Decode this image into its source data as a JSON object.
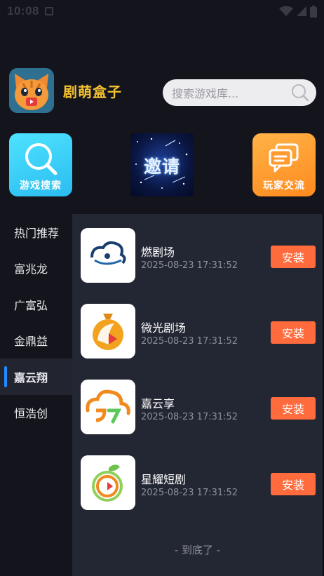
{
  "status_bar": {
    "time": "10:08"
  },
  "header": {
    "app_name": "剧萌盒子",
    "search_placeholder": "搜索游戏库..."
  },
  "quick_actions": [
    {
      "label": "游戏搜索",
      "icon": "magnifier-icon"
    },
    {
      "label": "邀请",
      "icon": "starry-invite-banner"
    },
    {
      "label": "玩家交流",
      "icon": "chat-bubbles-icon"
    }
  ],
  "sidebar": {
    "items": [
      {
        "label": "热门推荐"
      },
      {
        "label": "富兆龙"
      },
      {
        "label": "广富弘"
      },
      {
        "label": "金鼎益"
      },
      {
        "label": "嘉云翔"
      },
      {
        "label": "恒浩创"
      }
    ],
    "active_index": 4
  },
  "apps": [
    {
      "name": "燃剧场",
      "date": "2025-08-23 17:31:52",
      "button": "安装",
      "icon": "ran-juchang-logo"
    },
    {
      "name": "微光剧场",
      "date": "2025-08-23 17:31:52",
      "button": "安装",
      "icon": "weiguang-juchang-logo"
    },
    {
      "name": "嘉云享",
      "date": "2025-08-23 17:31:52",
      "button": "安装",
      "icon": "jiayunxiang-logo"
    },
    {
      "name": "星耀短剧",
      "date": "2025-08-23 17:31:52",
      "button": "安装",
      "icon": "xingyao-duanju-logo"
    }
  ],
  "footer_note": "- 到底了 -",
  "colors": {
    "background": "#14141c",
    "panel": "#232633",
    "accent_title": "#f5c230",
    "install_button": "#ff6b3d",
    "active_indicator": "#1d8cff"
  }
}
